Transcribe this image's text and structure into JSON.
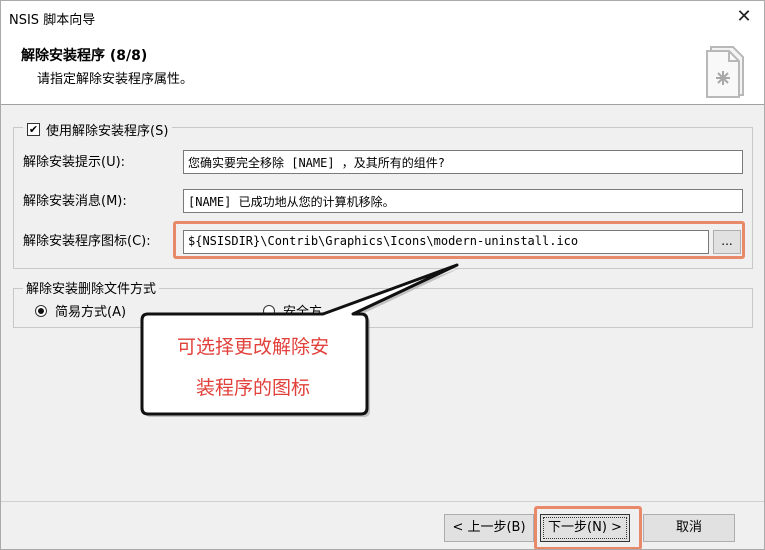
{
  "window": {
    "title": "NSIS 脚本向导",
    "close_glyph": "✕"
  },
  "header": {
    "title": "解除安装程序 (8/8)",
    "subtitle": "请指定解除安装程序属性。",
    "icon": "uninstall-document-icon"
  },
  "uninstaller_group": {
    "checkbox_label": "使用解除安装程序(S)",
    "checked": true,
    "fields": [
      {
        "label": "解除安装提示(U):",
        "value": "您确实要完全移除 [NAME] ，及其所有的组件?"
      },
      {
        "label": "解除安装消息(M):",
        "value": "[NAME] 已成功地从您的计算机移除。"
      },
      {
        "label": "解除安装程序图标(C):",
        "value": "${NSISDIR}\\Contrib\\Graphics\\Icons\\modern-uninstall.ico"
      }
    ],
    "browse_label": "..."
  },
  "delete_mode_group": {
    "legend": "解除安装删除文件方式",
    "options": [
      {
        "label": "简易方式(A)",
        "selected": true
      },
      {
        "label": "安全方",
        "selected": false
      }
    ]
  },
  "callout": {
    "line1": "可选择更改解除安",
    "line2": "装程序的图标"
  },
  "buttons": {
    "back": "< 上一步(B)",
    "next": "下一步(N) >",
    "cancel": "取消"
  },
  "colors": {
    "highlight": "#e88a6a",
    "callout_text": "#e2403a"
  }
}
